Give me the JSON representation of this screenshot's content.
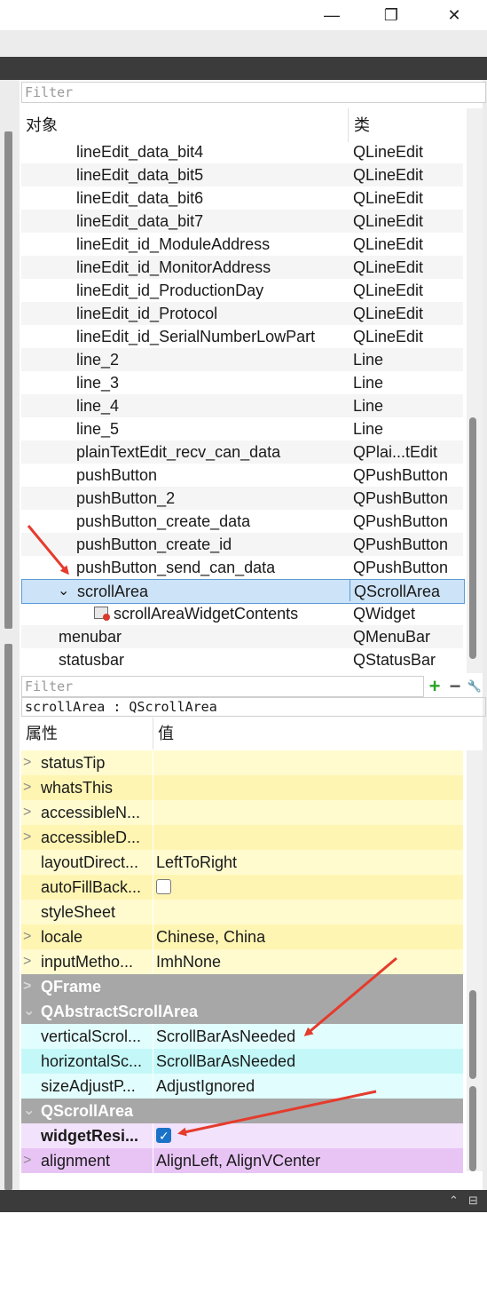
{
  "window": {
    "minimize_glyph": "—",
    "maximize_glyph": "❐",
    "close_glyph": "✕"
  },
  "object_inspector": {
    "filter_placeholder": "Filter",
    "header": {
      "col_object": "对象",
      "col_class": "类"
    },
    "rows": [
      {
        "name": "lineEdit_data_bit4",
        "cls": "QLineEdit"
      },
      {
        "name": "lineEdit_data_bit5",
        "cls": "QLineEdit"
      },
      {
        "name": "lineEdit_data_bit6",
        "cls": "QLineEdit"
      },
      {
        "name": "lineEdit_data_bit7",
        "cls": "QLineEdit"
      },
      {
        "name": "lineEdit_id_ModuleAddress",
        "cls": "QLineEdit"
      },
      {
        "name": "lineEdit_id_MonitorAddress",
        "cls": "QLineEdit"
      },
      {
        "name": "lineEdit_id_ProductionDay",
        "cls": "QLineEdit"
      },
      {
        "name": "lineEdit_id_Protocol",
        "cls": "QLineEdit"
      },
      {
        "name": "lineEdit_id_SerialNumberLowPart",
        "cls": "QLineEdit"
      },
      {
        "name": "line_2",
        "cls": "Line"
      },
      {
        "name": "line_3",
        "cls": "Line"
      },
      {
        "name": "line_4",
        "cls": "Line"
      },
      {
        "name": "line_5",
        "cls": "Line"
      },
      {
        "name": "plainTextEdit_recv_can_data",
        "cls": "QPlai...tEdit"
      },
      {
        "name": "pushButton",
        "cls": "QPushButton"
      },
      {
        "name": "pushButton_2",
        "cls": "QPushButton"
      },
      {
        "name": "pushButton_create_data",
        "cls": "QPushButton"
      },
      {
        "name": "pushButton_create_id",
        "cls": "QPushButton"
      },
      {
        "name": "pushButton_send_can_data",
        "cls": "QPushButton"
      },
      {
        "name": "scrollArea",
        "cls": "QScrollArea",
        "selected": true,
        "expander": "⌄"
      },
      {
        "name": "scrollAreaWidgetContents",
        "cls": "QWidget",
        "icon": "widget-icon"
      },
      {
        "name": "menubar",
        "cls": "QMenuBar"
      },
      {
        "name": "statusbar",
        "cls": "QStatusBar"
      }
    ]
  },
  "property_editor": {
    "filter_placeholder": "Filter",
    "add_glyph": "+",
    "remove_glyph": "−",
    "configure_glyph": "🔧",
    "object_label": "scrollArea : QScrollArea",
    "header": {
      "col_property": "属性",
      "col_value": "值"
    },
    "rows": [
      {
        "type": "prop",
        "arrow": ">",
        "name": "statusTip",
        "value": "",
        "tone": "y1"
      },
      {
        "type": "prop",
        "arrow": ">",
        "name": "whatsThis",
        "value": "",
        "tone": "y2"
      },
      {
        "type": "prop",
        "arrow": ">",
        "name": "accessibleN...",
        "value": "",
        "tone": "y1"
      },
      {
        "type": "prop",
        "arrow": ">",
        "name": "accessibleD...",
        "value": "",
        "tone": "y2"
      },
      {
        "type": "prop",
        "arrow": "",
        "name": "layoutDirect...",
        "value": "LeftToRight",
        "tone": "y1"
      },
      {
        "type": "check",
        "arrow": "",
        "name": "autoFillBack...",
        "checked": false,
        "tone": "y2"
      },
      {
        "type": "prop",
        "arrow": "",
        "name": "styleSheet",
        "value": "",
        "tone": "y1"
      },
      {
        "type": "prop",
        "arrow": ">",
        "name": "locale",
        "value": "Chinese, China",
        "tone": "y2"
      },
      {
        "type": "prop",
        "arrow": ">",
        "name": "inputMetho...",
        "value": "ImhNone",
        "tone": "y1"
      },
      {
        "type": "group",
        "arrow": ">",
        "name": "QFrame"
      },
      {
        "type": "group",
        "arrow": "⌄",
        "name": "QAbstractScrollArea"
      },
      {
        "type": "prop",
        "arrow": "",
        "name": "verticalScrol...",
        "value": "ScrollBarAsNeeded",
        "tone": "c1r"
      },
      {
        "type": "prop",
        "arrow": "",
        "name": "horizontalSc...",
        "value": "ScrollBarAsNeeded",
        "tone": "c2r"
      },
      {
        "type": "prop",
        "arrow": "",
        "name": "sizeAdjustP...",
        "value": "AdjustIgnored",
        "tone": "c1r"
      },
      {
        "type": "group",
        "arrow": "⌄",
        "name": "QScrollArea"
      },
      {
        "type": "check",
        "arrow": "",
        "name": "widgetResi...",
        "checked": true,
        "bold": true,
        "tone": "m1"
      },
      {
        "type": "prop",
        "arrow": ">",
        "name": "alignment",
        "value": "AlignLeft, AlignVCenter",
        "tone": "m2"
      }
    ]
  },
  "bottom": {
    "collapse_glyph": "⌃",
    "restore_glyph": "⊟"
  },
  "colors": {
    "annotation_arrow": "#e53b2c",
    "selection": "#cde3f7",
    "group_header": "#a7a7a7"
  }
}
